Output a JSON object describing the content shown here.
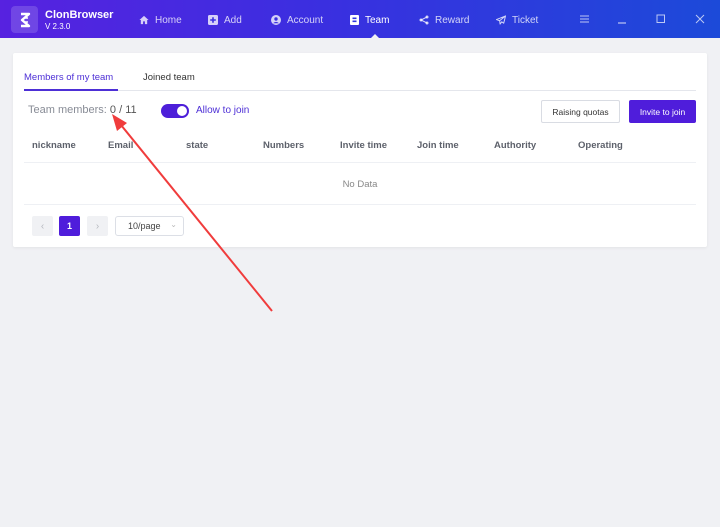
{
  "app": {
    "name": "ClonBrowser",
    "version": "V 2.3.0"
  },
  "nav": [
    {
      "label": "Home",
      "icon": "home-icon"
    },
    {
      "label": "Add",
      "icon": "plus-square-icon"
    },
    {
      "label": "Account",
      "icon": "user-circle-icon"
    },
    {
      "label": "Team",
      "icon": "id-badge-icon",
      "active": true
    },
    {
      "label": "Reward",
      "icon": "share-icon"
    },
    {
      "label": "Ticket",
      "icon": "paper-plane-icon"
    }
  ],
  "window_controls": [
    "menu-icon",
    "minimize-icon",
    "maximize-icon",
    "close-icon"
  ],
  "tabs": [
    {
      "label": "Members of my team",
      "active": true
    },
    {
      "label": "Joined team",
      "active": false
    }
  ],
  "team": {
    "members_label": "Team members:",
    "members_count": "0 / 11",
    "allow_to_join_label": "Allow to join",
    "allow_to_join_enabled": true
  },
  "buttons": {
    "raising_quotas": "Raising quotas",
    "invite_to_join": "Invite to join"
  },
  "table": {
    "columns": [
      "nickname",
      "Email",
      "state",
      "Numbers",
      "Invite time",
      "Join time",
      "Authority",
      "Operating"
    ],
    "rows": [],
    "empty_text": "No Data"
  },
  "pagination": {
    "prev": "‹",
    "current_page": "1",
    "next": "›",
    "page_size": "10/page"
  },
  "colors": {
    "accent": "#4f1ddb",
    "header_start": "#5722e0",
    "header_end": "#1c4ad9",
    "annotation_arrow": "#f03c3c"
  }
}
